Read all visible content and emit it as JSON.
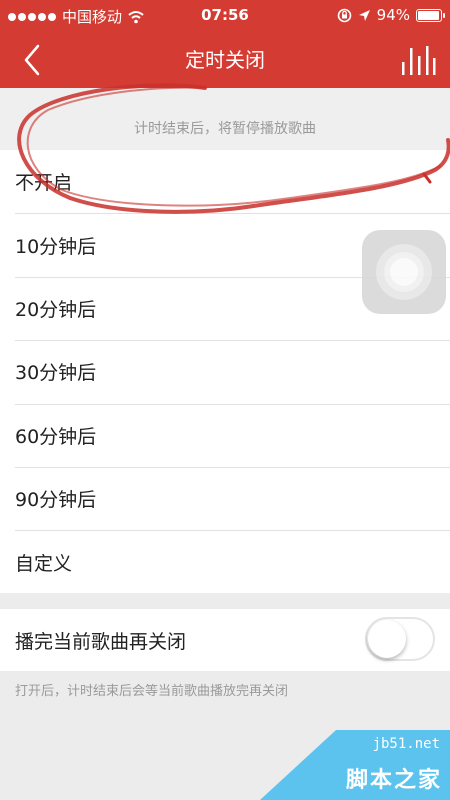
{
  "status_bar": {
    "carrier": "中国移动",
    "time": "07:56",
    "battery": "94%",
    "battery_level": 0.94
  },
  "nav": {
    "title": "定时关闭",
    "back_icon": "chevron-left-icon",
    "right_icon": "equalizer-icon"
  },
  "hint_top": "计时结束后，将暂停播放歌曲",
  "options": [
    {
      "label": "不开启"
    },
    {
      "label": "10分钟后"
    },
    {
      "label": "20分钟后"
    },
    {
      "label": "30分钟后"
    },
    {
      "label": "60分钟后"
    },
    {
      "label": "90分钟后"
    },
    {
      "label": "自定义"
    }
  ],
  "toggle": {
    "label": "播完当前歌曲再关闭",
    "on": false
  },
  "hint_bottom": "打开后，计时结束后会等当前歌曲播放完再关闭",
  "watermark": {
    "site": "jb51.net",
    "brand": "脚本之家"
  },
  "colors": {
    "header": "#d43c33",
    "annotation_stroke": "#c9302c",
    "watermark_blue": "#5cc3ee"
  }
}
